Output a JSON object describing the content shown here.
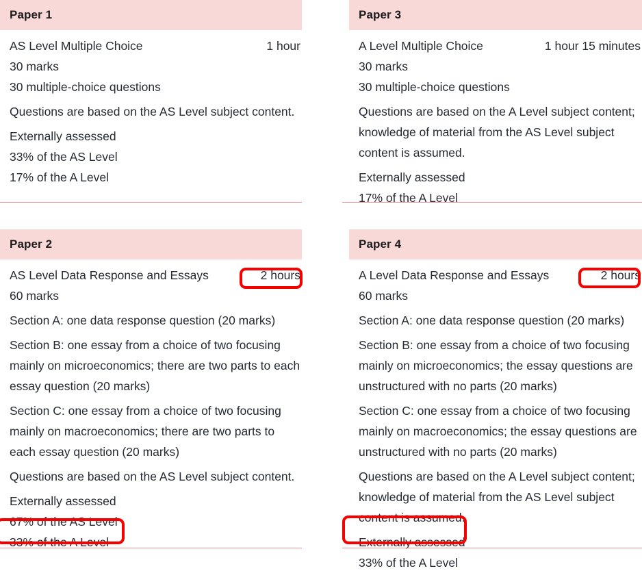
{
  "theme": {
    "header_bg": "#f9d8d8",
    "rule_color": "#eb8f93",
    "text_color": "#262b33",
    "annotation_color": "#f60000"
  },
  "papers": [
    {
      "title": "Paper 1",
      "name": "AS Level Multiple Choice",
      "duration": "1 hour",
      "lines": [
        "30 marks",
        "30 multiple-choice questions",
        "Questions are based on the AS Level subject content.",
        "Externally assessed",
        "33% of the AS Level",
        "17% of the A Level"
      ]
    },
    {
      "title": "Paper 3",
      "name": "A Level Multiple Choice",
      "duration": "1 hour 15 minutes",
      "lines": [
        "30 marks",
        "30 multiple-choice questions",
        "Questions are based on the A Level subject content; knowledge of material from the AS Level subject content is assumed.",
        "Externally assessed",
        "17% of the A Level"
      ]
    },
    {
      "title": "Paper 2",
      "name": "AS Level Data Response and Essays",
      "duration": "2 hours",
      "lines": [
        "60 marks",
        "Section A: one data response question (20 marks)",
        "Section B: one essay from a choice of two focusing mainly on microeconomics; there are two parts to each essay question (20 marks)",
        "Section C: one essay from a choice of two focusing mainly on macroeconomics; there are two parts to each essay question (20 marks)",
        "Questions are based on the AS Level subject content.",
        "Externally assessed",
        "67% of the AS Level",
        "33% of the A Level"
      ]
    },
    {
      "title": "Paper 4",
      "name": "A Level Data Response and Essays",
      "duration": "2 hours",
      "lines": [
        "60 marks",
        "Section A: one data response question (20 marks)",
        "Section B: one essay from a choice of two focusing mainly on microeconomics; the essay questions are unstructured with no parts (20 marks)",
        "Section C: one essay from a choice of two focusing mainly on macroeconomics; the essay questions are unstructured with no parts (20 marks)",
        "Questions are based on the A Level subject content; knowledge of material from the AS Level subject content is assumed.",
        "Externally assessed",
        "33% of the A Level"
      ]
    }
  ],
  "annotations": [
    {
      "target": "paper-2-duration",
      "label": "2 hours"
    },
    {
      "target": "paper-4-duration",
      "label": "2 hours"
    },
    {
      "target": "paper-2-a-level-weighting",
      "label": "33% of the A Level"
    },
    {
      "target": "paper-4-a-level-weighting",
      "label": "33% of the A Level"
    }
  ]
}
